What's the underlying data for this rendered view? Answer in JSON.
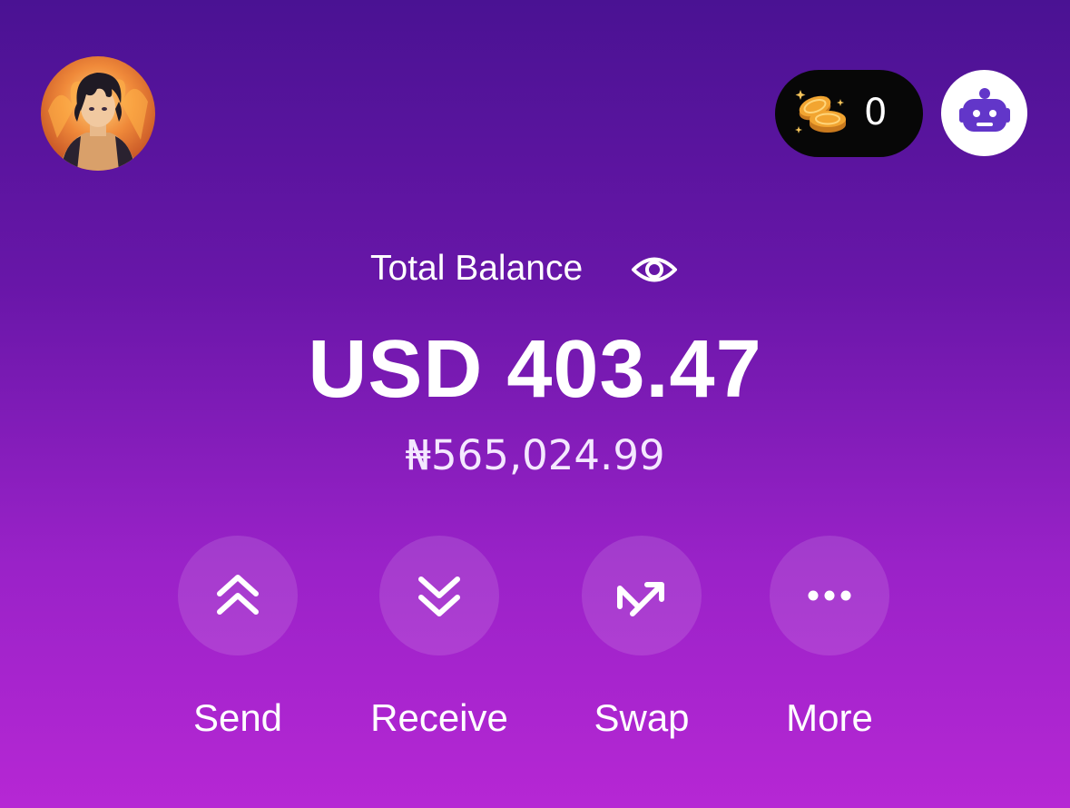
{
  "header": {
    "avatar_alt": "User avatar",
    "coins": {
      "count": "0"
    }
  },
  "balance": {
    "label": "Total Balance",
    "amount": "USD 403.47",
    "secondary": "₦565,024.99"
  },
  "actions": [
    {
      "label": "Send",
      "icon": "double-chevron-up-icon"
    },
    {
      "label": "Receive",
      "icon": "double-chevron-down-icon"
    },
    {
      "label": "Swap",
      "icon": "swap-arrows-icon"
    },
    {
      "label": "More",
      "icon": "more-dots-icon"
    }
  ],
  "colors": {
    "gradient_top": "#4a1293",
    "gradient_bottom": "#b627d4",
    "coin_pill": "#070707",
    "bot_icon": "#6236c9",
    "coin_gold": "#f2a531"
  }
}
